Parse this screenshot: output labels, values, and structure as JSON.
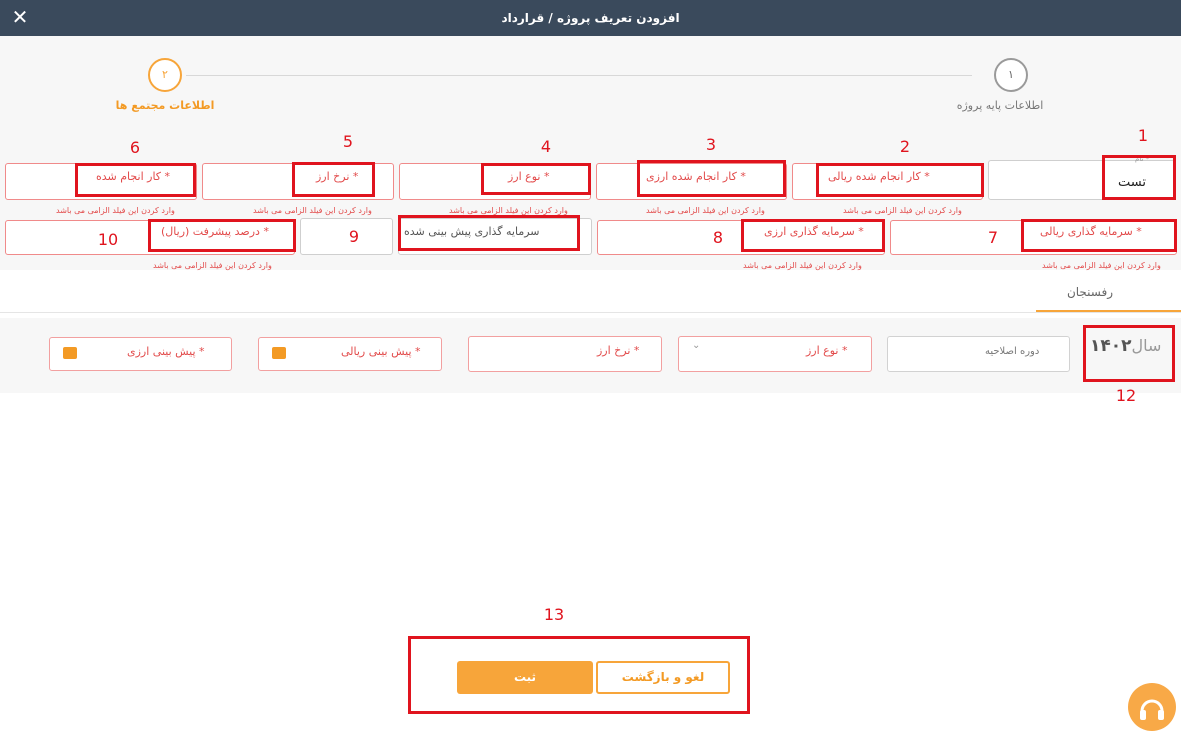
{
  "dialog": {
    "title": "افزودن تعریف پروژه / قرارداد",
    "close_icon": "close-icon"
  },
  "stepper": {
    "step1": {
      "number": "۱",
      "label": "اطلاعات پایه پروژه"
    },
    "step2": {
      "number": "۲",
      "label": "اطلاعات مجتمع ها"
    }
  },
  "form": {
    "name_label": "نام *",
    "name_value": "تست",
    "required_error": "وارد کردن این فیلد الزامی می باشد",
    "rial_work_done": "کار انجام شده ریالی *",
    "fx_work_done": "کار انجام شده ارزی *",
    "currency_type": "نوع ارز *",
    "exchange_rate": "نرخ ارز *",
    "work_done": "کار انجام شده *",
    "rial_investment": "سرمایه گذاری ریالی *",
    "fx_investment": "سرمایه گذاری ارزی *",
    "forecast_investment": "سرمایه گذاری پیش بینی شده",
    "progress_percent": "درصد پیشرفت (ریال) *"
  },
  "tab": {
    "label": "رفسنجان"
  },
  "year_row": {
    "year_label": "سال",
    "year_value": "۱۴۰۲",
    "revision_period": "دوره اصلاحیه",
    "currency_type": "نوع ارز *",
    "exchange_rate": "نرخ ارز *",
    "rial_forecast": "پیش بینی ریالی *",
    "fx_forecast": "پیش بینی ارزی *"
  },
  "annotations": [
    "1",
    "2",
    "3",
    "4",
    "5",
    "6",
    "7",
    "8",
    "9",
    "10",
    "12",
    "13"
  ],
  "buttons": {
    "save": "ثبت",
    "cancel": "لغو و بازگشت"
  },
  "colors": {
    "accent": "#f7a53a",
    "header": "#3a4a5c",
    "error": "#e24a4a",
    "annotation": "#e0141e"
  }
}
